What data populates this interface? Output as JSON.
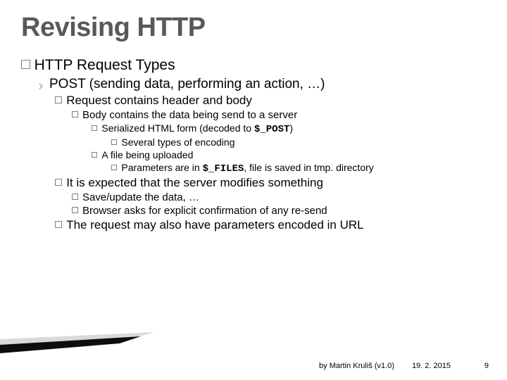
{
  "title": "Revising HTTP",
  "b1": {
    "label": "HTTP Request Types"
  },
  "b2": {
    "label": "POST (sending data, performing an action, …)"
  },
  "b3a": "Request contains header and body",
  "b4a": "Body contains the data being send to a server",
  "b5a_pre": "Serialized HTML form (decoded to ",
  "b5a_code": "$_POST",
  "b5a_post": ")",
  "b6a": "Several types of encoding",
  "b5b": "A file being uploaded",
  "b6b_pre": "Parameters are in ",
  "b6b_code": "$_FILES",
  "b6b_post": ", file is saved in tmp. directory",
  "b3b": "It is expected that the server modifies something",
  "b4b": "Save/update the data, …",
  "b4c": "Browser asks for explicit confirmation of any re-send",
  "b3c": "The request may also have parameters encoded in URL",
  "footer": {
    "by": "by Martin Kruliš (v1.0)",
    "date": "19. 2. 2015",
    "page": "9"
  }
}
